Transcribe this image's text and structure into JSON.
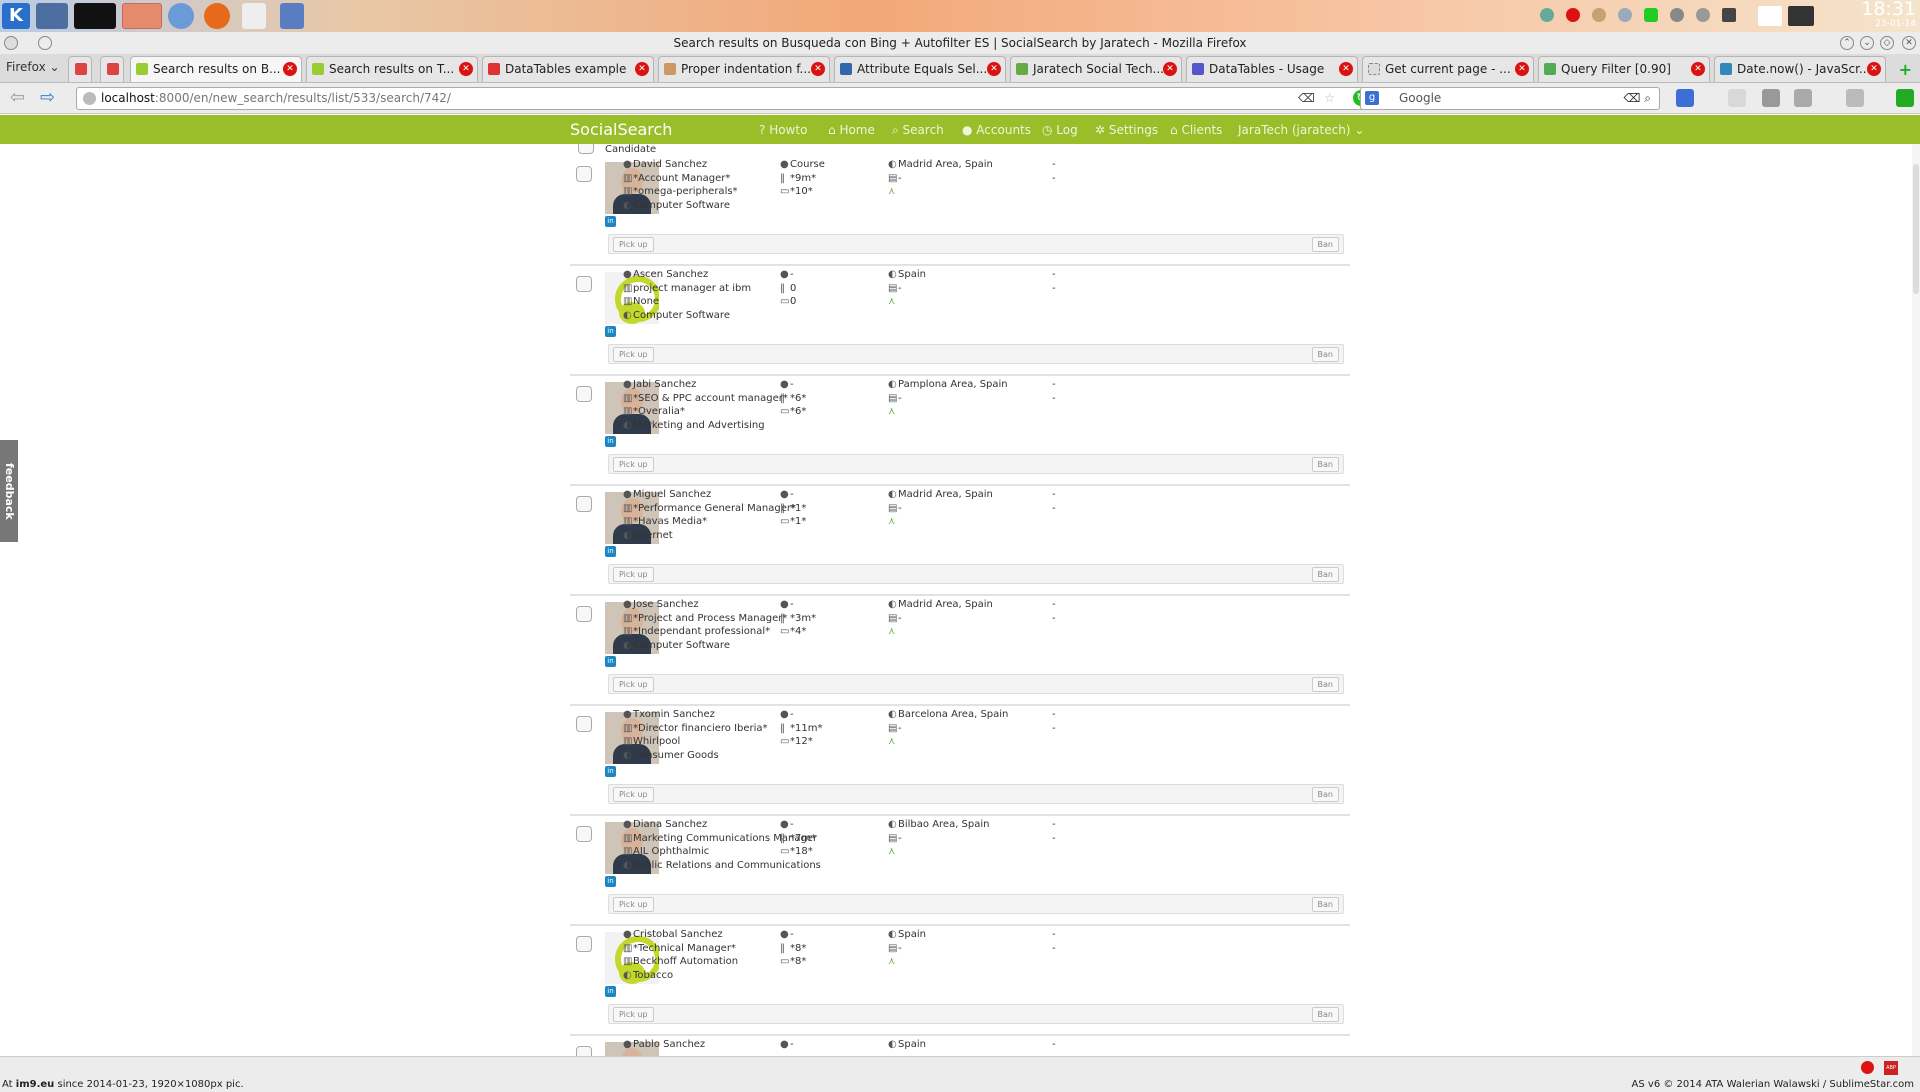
{
  "taskbar": {
    "clock_time": "18:31",
    "clock_date": "23-01-14"
  },
  "window": {
    "title": "Search results on Busqueda con Bing + Autofilter ES | SocialSearch by Jaratech - Mozilla Firefox"
  },
  "browser": {
    "menu_label": "Firefox",
    "tabs": [
      {
        "label": "Search results on B..."
      },
      {
        "label": "Search results on T..."
      },
      {
        "label": "DataTables example"
      },
      {
        "label": "Proper indentation f..."
      },
      {
        "label": "Attribute Equals Sel..."
      },
      {
        "label": "Jaratech Social Tech..."
      },
      {
        "label": "DataTables - Usage"
      },
      {
        "label": "Get current page - ..."
      },
      {
        "label": "Query Filter [0.90]"
      },
      {
        "label": "Date.now() - JavaScr..."
      }
    ],
    "url_host": "localhost",
    "url_path": ":8000/en/new_search/results/list/533/search/742/",
    "search_placeholder": "Google"
  },
  "app": {
    "brand": "SocialSearch",
    "nav": [
      {
        "label": "Howto"
      },
      {
        "label": "Home"
      },
      {
        "label": "Search"
      },
      {
        "label": "Accounts"
      },
      {
        "label": "Log"
      },
      {
        "label": "Settings"
      },
      {
        "label": "Clients"
      },
      {
        "label": "JaraTech (jaratech)"
      }
    ],
    "list_header": "Candidate",
    "pickup_label": "Pick up",
    "ban_label": "Ban",
    "feedback_label": "feedback"
  },
  "candidates": [
    {
      "name": "David Sanchez",
      "title": "*Account Manager*",
      "company": "*omega-peripherals*",
      "industry": "Computer Software",
      "edu": "Course",
      "exp": "*9m*",
      "years": "*10*",
      "location": "Madrid Area, Spain",
      "connections": "-",
      "c1": "-",
      "c2": "-",
      "photo": "person"
    },
    {
      "name": "Ascen Sanchez",
      "title": "project manager at ibm",
      "company": "None",
      "industry": "Computer Software",
      "edu": "-",
      "exp": "0",
      "years": "0",
      "location": "Spain",
      "connections": "-",
      "c1": "-",
      "c2": "-",
      "photo": "placeholder"
    },
    {
      "name": "Jabi Sanchez",
      "title": "*SEO & PPC account manager*",
      "company": "*Overalia*",
      "industry": "Marketing and Advertising",
      "edu": "-",
      "exp": "*6*",
      "years": "*6*",
      "location": "Pamplona Area, Spain",
      "connections": "-",
      "c1": "-",
      "c2": "-",
      "photo": "person"
    },
    {
      "name": "Miguel Sanchez",
      "title": "*Performance General Manager*",
      "company": "*Havas Media*",
      "industry": "Internet",
      "edu": "-",
      "exp": "*1*",
      "years": "*1*",
      "location": "Madrid Area, Spain",
      "connections": "-",
      "c1": "-",
      "c2": "-",
      "photo": "person"
    },
    {
      "name": "Jose Sanchez",
      "title": "*Project and Process Manager*",
      "company": "*Independant professional*",
      "industry": "Computer Software",
      "edu": "-",
      "exp": "*3m*",
      "years": "*4*",
      "location": "Madrid Area, Spain",
      "connections": "-",
      "c1": "-",
      "c2": "-",
      "photo": "person"
    },
    {
      "name": "Txomin Sanchez",
      "title": "*Director financiero Iberia*",
      "company": "Whirlpool",
      "industry": "Consumer Goods",
      "edu": "-",
      "exp": "*11m*",
      "years": "*12*",
      "location": "Barcelona Area, Spain",
      "connections": "-",
      "c1": "-",
      "c2": "-",
      "photo": "person"
    },
    {
      "name": "Diana Sanchez",
      "title": "Marketing Communications Manager",
      "company": "AJL Ophthalmic",
      "industry": "Public Relations and Communications",
      "edu": "-",
      "exp": "*7m*",
      "years": "*18*",
      "location": "Bilbao Area, Spain",
      "connections": "-",
      "c1": "-",
      "c2": "-",
      "photo": "person"
    },
    {
      "name": "Cristobal Sanchez",
      "title": "*Technical Manager*",
      "company": "Beckhoff Automation",
      "industry": "Tobacco",
      "edu": "-",
      "exp": "*8*",
      "years": "*8*",
      "location": "Spain",
      "connections": "-",
      "c1": "-",
      "c2": "-",
      "photo": "placeholder"
    },
    {
      "name": "Pablo Sanchez",
      "title": "",
      "company": "",
      "industry": "",
      "edu": "-",
      "exp": "",
      "years": "",
      "location": "Spain",
      "connections": "",
      "c1": "-",
      "c2": "",
      "photo": "person"
    }
  ],
  "status": {
    "footer_left_prefix": "At",
    "footer_left_site": "im9.eu",
    "footer_left_rest": "since 2014-01-23, 1920×1080px pic.",
    "footer_right": "AS v6 © 2014 ATA Walerian Walawski / SublimeStar.com"
  }
}
